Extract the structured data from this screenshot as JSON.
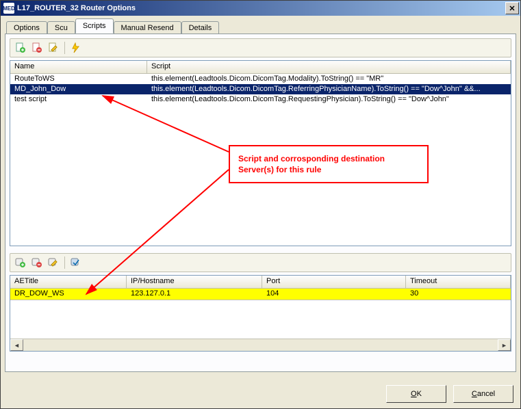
{
  "window": {
    "title": "L17_ROUTER_32 Router Options"
  },
  "tabs": [
    "Options",
    "Scu",
    "Scripts",
    "Manual Resend",
    "Details"
  ],
  "active_tab": "Scripts",
  "upper_grid": {
    "headers": [
      "Name",
      "Script"
    ],
    "rows": [
      {
        "name": "RouteToWS",
        "script": "this.element(Leadtools.Dicom.DicomTag.Modality).ToString() == \"MR\"",
        "selected": false
      },
      {
        "name": "MD_John_Dow",
        "script": "this.element(Leadtools.Dicom.DicomTag.ReferringPhysicianName).ToString() == \"Dow^John\" &&...",
        "selected": true
      },
      {
        "name": "test script",
        "script": "this.element(Leadtools.Dicom.DicomTag.RequestingPhysician).ToString() == \"Dow^John\"",
        "selected": false
      }
    ]
  },
  "lower_grid": {
    "headers": [
      "AETitle",
      "IP/Hostname",
      "Port",
      "Timeout"
    ],
    "rows": [
      {
        "ae": "DR_DOW_WS",
        "ip": "123.127.0.1",
        "port": "104",
        "timeout": "30"
      }
    ]
  },
  "annotation": {
    "line1": "Script and corrosponding destination",
    "line2": "Server(s) for this rule"
  },
  "buttons": {
    "ok_rest": "K",
    "cancel_rest": "ancel",
    "ok_u": "O",
    "cancel_u": "C"
  }
}
